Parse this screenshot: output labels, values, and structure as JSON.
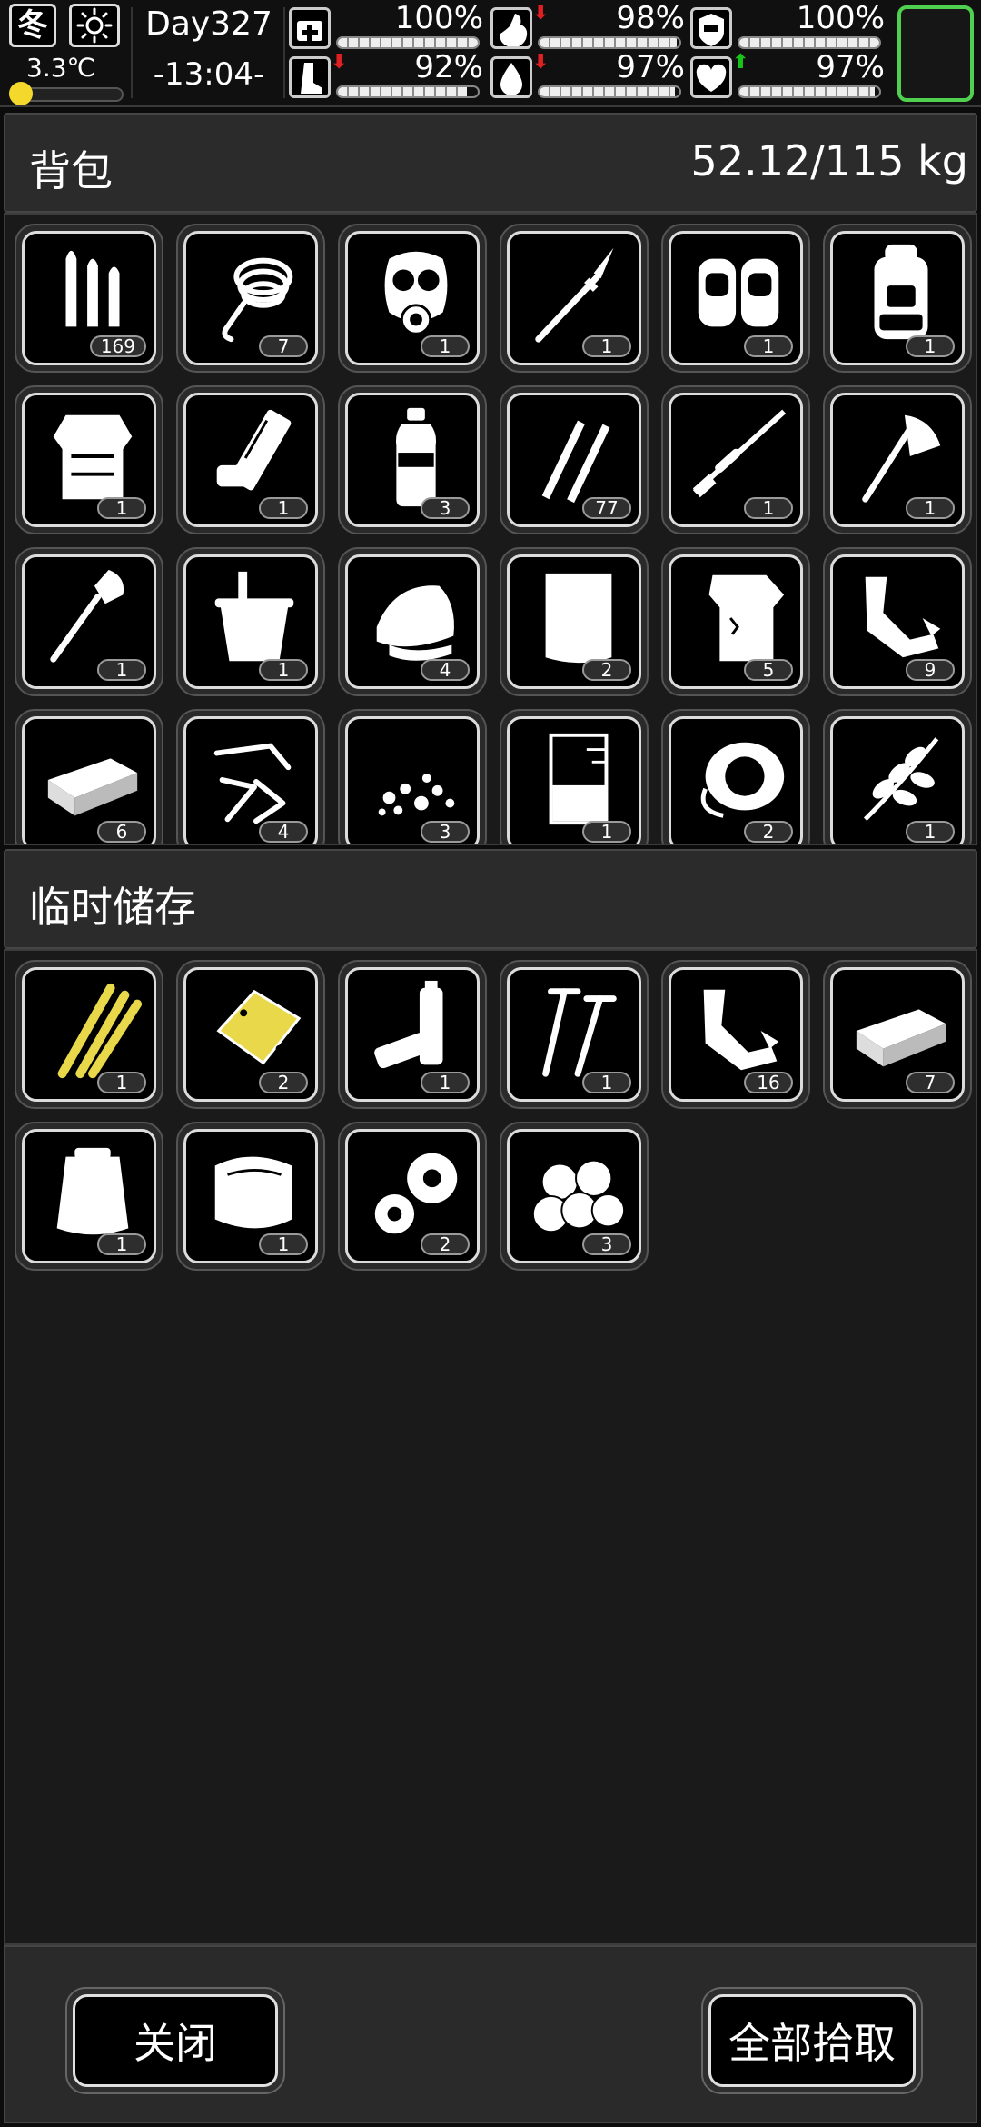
{
  "hud": {
    "season": "冬",
    "weather_icon": "sun-icon",
    "temperature": "3.3℃",
    "temperature_level": 0.08,
    "day": "Day327",
    "time": "-13:04-",
    "stats": [
      {
        "icon": "medkit-icon",
        "value": "100%",
        "level": 1.0,
        "trend": ""
      },
      {
        "icon": "stomach-icon",
        "value": "98%",
        "level": 0.98,
        "trend": "down"
      },
      {
        "icon": "shield-icon",
        "value": "100%",
        "level": 1.0,
        "trend": ""
      },
      {
        "icon": "leg-icon",
        "value": "92%",
        "level": 0.92,
        "trend": "down"
      },
      {
        "icon": "water-drop-icon",
        "value": "97%",
        "level": 0.97,
        "trend": "down"
      },
      {
        "icon": "heart-icon",
        "value": "97%",
        "level": 0.97,
        "trend": "up"
      }
    ],
    "colors": {
      "down_arrow": "#e02020",
      "up_arrow": "#18c418",
      "equip_border": "#4fd04f",
      "temp": "#f4d92c"
    }
  },
  "backpack": {
    "title": "背包",
    "weight": "52.12/115 kg",
    "items": [
      {
        "icon": "bullets-icon",
        "qty": "169"
      },
      {
        "icon": "rope-icon",
        "qty": "7"
      },
      {
        "icon": "gas-mask-icon",
        "qty": "1"
      },
      {
        "icon": "spear-icon",
        "qty": "1"
      },
      {
        "icon": "knee-pads-icon",
        "qty": "1"
      },
      {
        "icon": "backpack-icon",
        "qty": "1"
      },
      {
        "icon": "body-armor-icon",
        "qty": "1"
      },
      {
        "icon": "minigun-icon",
        "qty": "1"
      },
      {
        "icon": "water-bottle-icon",
        "qty": "3"
      },
      {
        "icon": "rifle-rounds-icon",
        "qty": "77"
      },
      {
        "icon": "sniper-rifle-icon",
        "qty": "1"
      },
      {
        "icon": "axe-icon",
        "qty": "1"
      },
      {
        "icon": "shovel-icon",
        "qty": "1"
      },
      {
        "icon": "bucket-icon",
        "qty": "1"
      },
      {
        "icon": "cloth-icon",
        "qty": "4"
      },
      {
        "icon": "fabric-sheet-icon",
        "qty": "2"
      },
      {
        "icon": "torn-shirt-icon",
        "qty": "5"
      },
      {
        "icon": "scrap-leather-icon",
        "qty": "9"
      },
      {
        "icon": "metal-ingot-icon",
        "qty": "6"
      },
      {
        "icon": "scrap-metal-icon",
        "qty": "4"
      },
      {
        "icon": "gravel-icon",
        "qty": "3"
      },
      {
        "icon": "beaker-icon",
        "qty": "1"
      },
      {
        "icon": "duct-tape-icon",
        "qty": "2"
      },
      {
        "icon": "herb-icon",
        "qty": "1"
      }
    ]
  },
  "storage": {
    "title": "临时储存",
    "items": [
      {
        "icon": "bamboo-sticks-icon",
        "qty": "1"
      },
      {
        "icon": "gold-plate-icon",
        "qty": "2"
      },
      {
        "icon": "batteries-icon",
        "qty": "1"
      },
      {
        "icon": "screws-icon",
        "qty": "1"
      },
      {
        "icon": "scrap-leather-icon",
        "qty": "16"
      },
      {
        "icon": "metal-ingot-icon",
        "qty": "7"
      },
      {
        "icon": "plastic-bag-icon",
        "qty": "1"
      },
      {
        "icon": "plastic-sheet-icon",
        "qty": "1"
      },
      {
        "icon": "gears-icon",
        "qty": "2"
      },
      {
        "icon": "cotton-balls-icon",
        "qty": "3"
      }
    ]
  },
  "footer": {
    "close_label": "关闭",
    "take_all_label": "全部拾取"
  }
}
